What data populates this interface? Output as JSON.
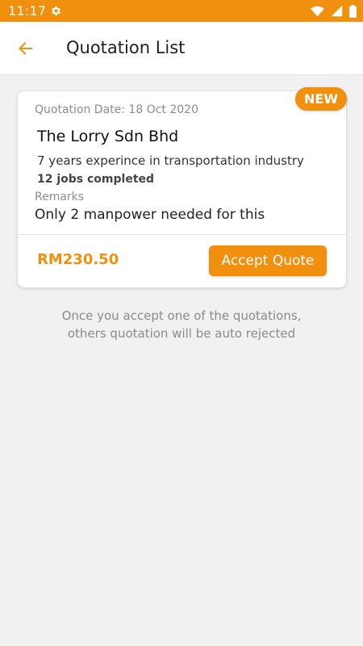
{
  "status_bar": {
    "time": "11:17",
    "icons": [
      "gear-icon",
      "wifi-icon",
      "signal-icon",
      "battery-icon"
    ]
  },
  "header": {
    "title": "Quotation List",
    "back_icon": "back-arrow-icon"
  },
  "quotation": {
    "badge": "NEW",
    "date": "Quotation Date: 18 Oct 2020",
    "company": "The Lorry Sdn Bhd",
    "experience": "7 years experince in transportation industry",
    "jobs": "12 jobs completed",
    "remarks_label": "Remarks",
    "remarks": "Only 2 manpower needed for this",
    "price": "RM230.50",
    "accept_label": "Accept Quote"
  },
  "notice": {
    "line1": "Once you accept one of the quotations,",
    "line2": "others quotation will be auto rejected"
  },
  "colors": {
    "accent": "#f1900e",
    "background": "#f1f1f1",
    "card": "#ffffff"
  }
}
